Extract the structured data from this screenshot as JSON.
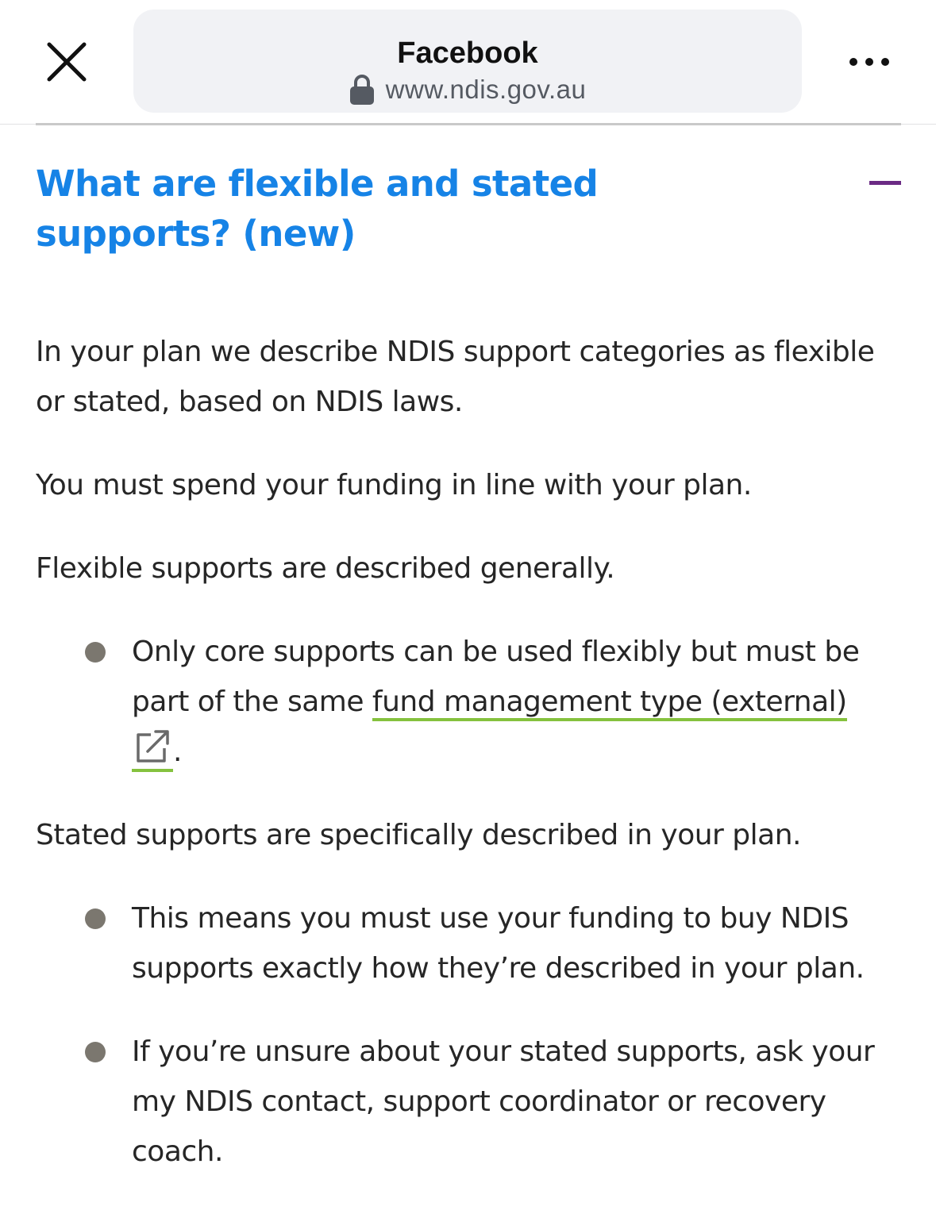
{
  "browser": {
    "title": "Facebook",
    "url": "www.ndis.gov.au"
  },
  "accordion": {
    "title": "What are flexible and stated supports? (new)",
    "state": "expanded",
    "accent_color": "#6b2a84",
    "title_color": "#1683e6"
  },
  "content": {
    "paragraph_1": "In your plan we describe NDIS support categories as flexible or stated, based on NDIS laws.",
    "paragraph_2": "You must spend your funding in line with your plan.",
    "paragraph_3": "Flexible supports are described generally.",
    "flexible_bullet": {
      "text_before": "Only core supports can be used flexibly but must be part of the same ",
      "link_text": "fund management type (external)",
      "text_after": "."
    },
    "paragraph_4": "Stated supports are specifically described in your plan.",
    "stated_bullets": [
      "This means you must use your funding to buy NDIS supports exactly how they’re described in your plan.",
      "If you’re unsure about your stated supports, ask your my NDIS contact, support coordinator or recovery coach."
    ]
  },
  "icons": {
    "close": "close-icon",
    "lock": "lock-icon",
    "more": "more-options-icon",
    "collapse": "minus-icon",
    "external": "external-link-icon"
  },
  "colors": {
    "link_underline": "#85c23e",
    "bullet": "#7b776f"
  }
}
